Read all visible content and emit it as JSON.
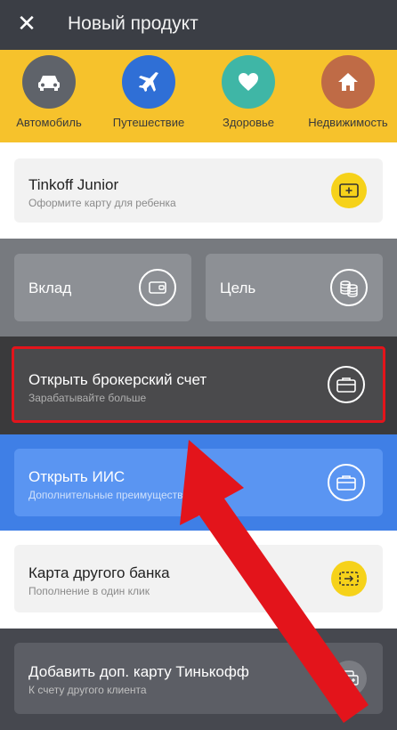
{
  "header": {
    "title": "Новый продукт",
    "close_icon": "close-icon"
  },
  "categories": [
    {
      "label": "Автомобиль",
      "icon": "car-icon",
      "color": "#5f636a"
    },
    {
      "label": "Путешествие",
      "icon": "airplane-icon",
      "color": "#2f6fd6"
    },
    {
      "label": "Здоровье",
      "icon": "heart-icon",
      "color": "#3fb6a6"
    },
    {
      "label": "Недвижимость",
      "icon": "home-icon",
      "color": "#bf6b46"
    }
  ],
  "products": {
    "junior": {
      "title": "Tinkoff Junior",
      "subtitle": "Оформите карту для ребенка",
      "icon": "card-plus-icon"
    },
    "deposit": {
      "title": "Вклад",
      "icon": "wallet-icon"
    },
    "goal": {
      "title": "Цель",
      "icon": "coins-icon"
    },
    "broker": {
      "title": "Открыть брокерский счет",
      "subtitle": "Зарабатывайте больше",
      "icon": "briefcase-icon"
    },
    "iis": {
      "title": "Открыть ИИС",
      "subtitle": "Дополнительные преимущества",
      "icon": "briefcase-icon"
    },
    "other_bank": {
      "title": "Карта другого банка",
      "subtitle": "Пополнение в один клик",
      "icon": "card-transfer-icon"
    },
    "extra_card": {
      "title": "Добавить доп. карту Тинькофф",
      "subtitle": "К счету другого клиента",
      "icon": "cards-icon"
    }
  },
  "colors": {
    "accent_yellow": "#f6c22c",
    "highlight_red": "#e3141b",
    "iis_blue": "#4a8ef0"
  }
}
